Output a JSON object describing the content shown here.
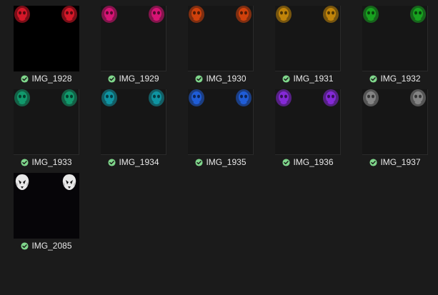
{
  "status_icon": "check-circle-icon",
  "accent": "#7fd68b",
  "items": [
    {
      "name": "IMG_1928",
      "color": "#e01a2b",
      "selected": true
    },
    {
      "name": "IMG_1929",
      "color": "#e0147a"
    },
    {
      "name": "IMG_1930",
      "color": "#d8440c"
    },
    {
      "name": "IMG_1931",
      "color": "#c98a0a"
    },
    {
      "name": "IMG_1932",
      "color": "#18a820"
    },
    {
      "name": "IMG_1933",
      "color": "#12a070"
    },
    {
      "name": "IMG_1934",
      "color": "#109aa8"
    },
    {
      "name": "IMG_1935",
      "color": "#2060e0"
    },
    {
      "name": "IMG_1936",
      "color": "#8a2ae0"
    },
    {
      "name": "IMG_1937",
      "color": "#8a8a8a"
    },
    {
      "name": "IMG_2085",
      "color": "#ffffff",
      "dark": true
    }
  ]
}
